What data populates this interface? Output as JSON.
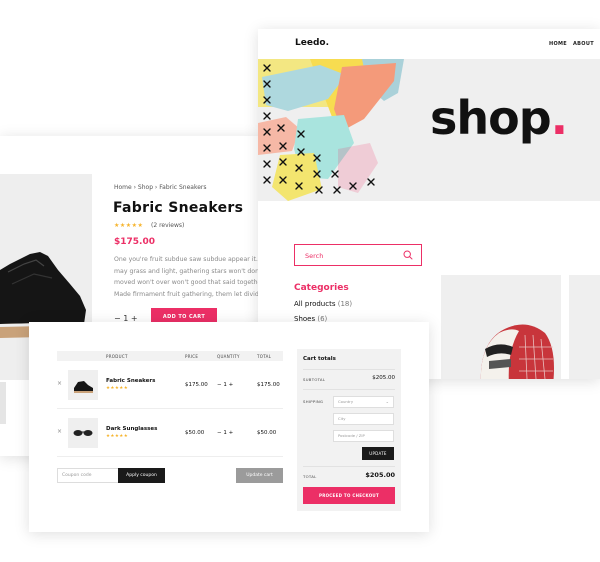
{
  "product": {
    "breadcrumb": "Home › Shop › Fabric Sneakers",
    "title": "Fabric Sneakers",
    "stars": "★★★★★",
    "reviews": "(2 reviews)",
    "price": "$175.00",
    "description": [
      "One you're fruit subdue saw subdue appear it. V",
      "may grass and light, gathering stars won't don'",
      "moved won't over won't good that said together",
      "Made firmament fruit gathering, them let divide"
    ],
    "qty": "−   1   +",
    "add_to_cart": "ADD TO CART"
  },
  "shop": {
    "logo": "Leedo.",
    "nav": {
      "home": "HOME",
      "about": "ABOUT"
    },
    "hero_title": "shop",
    "hero_dot": ".",
    "search_placeholder": "Serch",
    "categories_title": "Categories",
    "categories": [
      {
        "name": "All products",
        "count": "(18)"
      },
      {
        "name": "Shoes",
        "count": "(6)"
      }
    ]
  },
  "cart": {
    "headers": {
      "product": "PRODUCT",
      "price": "PRICE",
      "quantity": "QUANTITY",
      "total": "TOTAL"
    },
    "rows": [
      {
        "name": "Fabric Sneakers",
        "stars": "★★★★★",
        "price": "$175.00",
        "qty": "−  1  +",
        "total": "$175.00",
        "remove": "×"
      },
      {
        "name": "Dark Sunglasses",
        "stars": "★★★★★",
        "price": "$50.00",
        "qty": "−  1  +",
        "total": "$50.00",
        "remove": "×"
      }
    ],
    "coupon_placeholder": "Coupon code",
    "apply_coupon": "Apply coupon",
    "update_cart": "Update cart"
  },
  "totals": {
    "title": "Cart totals",
    "subtotal_label": "SUBTOTAL",
    "subtotal_value": "$205.00",
    "shipping_label": "SHIPPING",
    "country_placeholder": "Country",
    "city_placeholder": "City",
    "postcode_placeholder": "Postcode / ZIP",
    "update": "UPDATE",
    "total_label": "TOTAL",
    "total_value": "$205.00",
    "checkout": "PROCEED TO CHECKOUT"
  },
  "colors": {
    "accent": "#ec2f66",
    "star": "#f6b42d",
    "dark": "#1a1a1a"
  }
}
